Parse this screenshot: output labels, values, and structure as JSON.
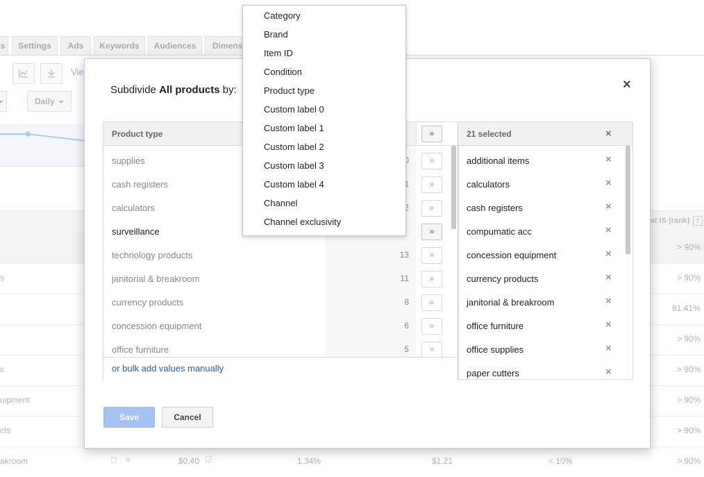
{
  "background": {
    "tabs": [
      "s",
      "Settings",
      "Ads",
      "Keywords",
      "Audiences",
      "Dimensi"
    ],
    "view_link": "Vie",
    "segment_button": "",
    "daily_button": "Daily",
    "column_header_rank": "ost IS (rank)",
    "help_mark": "?",
    "row_labels": [
      "s",
      "c",
      "uipment",
      "cts",
      "akroom"
    ],
    "rank_values": [
      "> 90%",
      "> 90%",
      "81.41%",
      "> 90%",
      "> 90%",
      "> 90%",
      "> 90%",
      "> 90%"
    ],
    "bottom_row": {
      "bid": "$0.40",
      "ctr": "1.34%",
      "cost": "$1.21",
      "share": "< 10%"
    }
  },
  "dialog": {
    "title_prefix": "Subdivide ",
    "title_bold": "All products",
    "title_suffix": " by:",
    "close_label": "×",
    "left_panel": {
      "header": "Product type",
      "move_all_label": "»",
      "items": [
        {
          "name": "supplies",
          "count": "0"
        },
        {
          "name": "cash registers",
          "count": "1"
        },
        {
          "name": "calculators",
          "count": "2"
        },
        {
          "name": "surveillance",
          "count": ""
        },
        {
          "name": "technology products",
          "count": "13"
        },
        {
          "name": "janitorial & breakroom",
          "count": "11"
        },
        {
          "name": "currency products",
          "count": "8"
        },
        {
          "name": "concession equipment",
          "count": "6"
        },
        {
          "name": "office furniture",
          "count": "5"
        }
      ],
      "bulk_link": "or bulk add values manually"
    },
    "right_panel": {
      "header": "21 selected",
      "clear_label": "×",
      "items": [
        "additional items",
        "calculators",
        "cash registers",
        "compumatic acc",
        "concession equipment",
        "currency products",
        "janitorial & breakroom",
        "office furniture",
        "office supplies",
        "paper cutters"
      ]
    },
    "save_label": "Save",
    "cancel_label": "Cancel"
  },
  "menu": {
    "items": [
      "Category",
      "Brand",
      "Item ID",
      "Condition",
      "Product type",
      "Custom label 0",
      "Custom label 1",
      "Custom label 2",
      "Custom label 3",
      "Custom label 4",
      "Channel",
      "Channel exclusivity"
    ]
  },
  "icons": {
    "chart_icon": "line-chart-icon",
    "download_icon": "download-icon",
    "remove_icon": "x-icon",
    "add_icon": "double-chevron-right-icon"
  },
  "colors": {
    "save_button": "#a4c2f4",
    "link": "#2a5db0",
    "chart_line": "#a9cdea"
  }
}
